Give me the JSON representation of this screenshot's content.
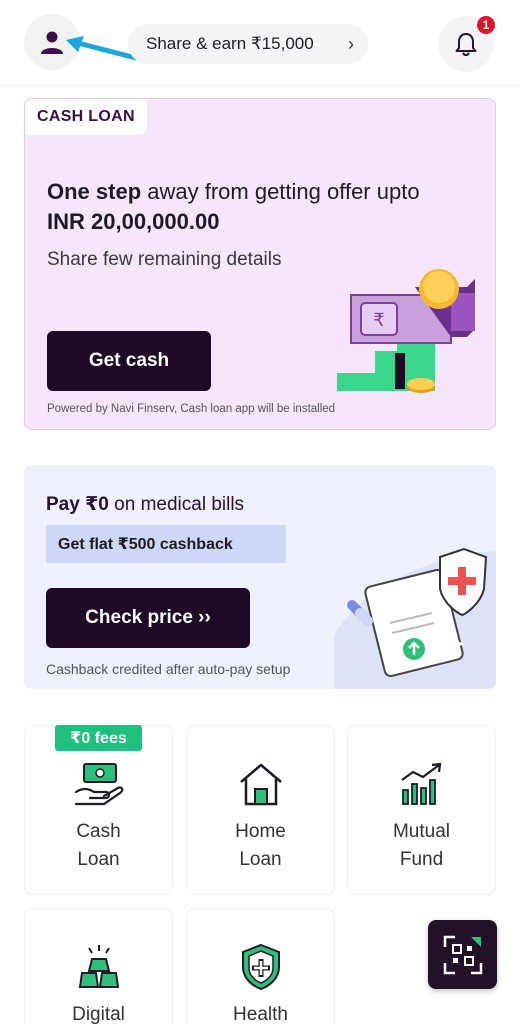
{
  "header": {
    "share_label": "Share & earn ₹15,000",
    "notification_count": "1"
  },
  "cash_loan_card": {
    "tag": "CASH LOAN",
    "title_bold": "One step",
    "title_rest": " away from getting offer upto",
    "title_amount": "INR 20,00,000.00",
    "subtitle": "Share few remaining details",
    "button": "Get cash",
    "footnote": "Powered by Navi Finserv, Cash loan app will be installed"
  },
  "medical_card": {
    "title_bold": "Pay ₹0",
    "title_rest": " on medical bills",
    "strip": "Get flat ₹500 cashback",
    "button": "Check price ››",
    "note": "Cashback credited after auto-pay setup"
  },
  "products": [
    {
      "line1": "Cash",
      "line2": "Loan",
      "icon": "cash-hand-icon"
    },
    {
      "line1": "Home",
      "line2": "Loan",
      "icon": "house-icon"
    },
    {
      "line1": "Mutual",
      "line2": "Fund",
      "icon": "growth-chart-icon"
    },
    {
      "line1": "Digital",
      "line2": "",
      "icon": "gold-bars-icon"
    },
    {
      "line1": "Health",
      "line2": "",
      "icon": "health-shield-icon"
    }
  ],
  "fee_badge": "₹0 fees",
  "colors": {
    "brand_dark": "#1e0a26",
    "accent_green": "#1fbf7d",
    "cash_card_bg": "#f5e6fb",
    "medical_card_bg": "#eef0fb",
    "notification_red": "#e4112d"
  }
}
